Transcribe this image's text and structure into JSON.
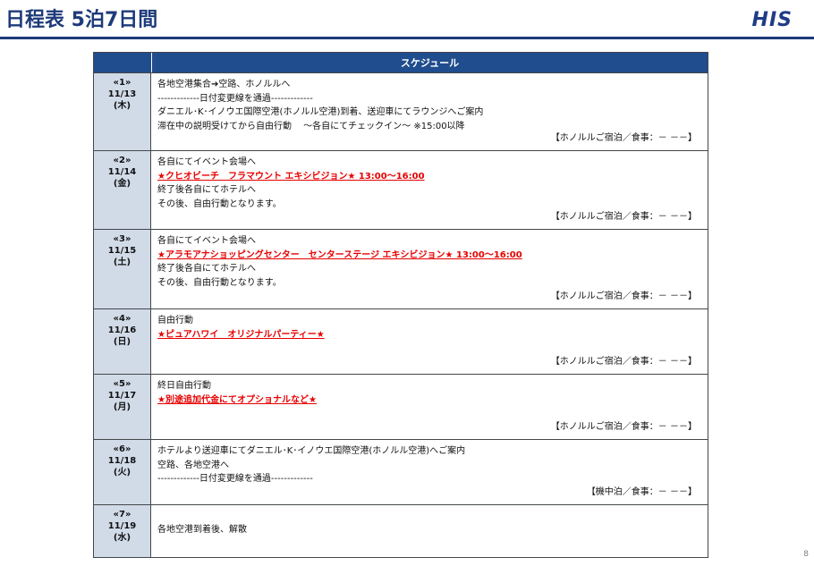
{
  "page": {
    "title": "日程表 5泊7日間",
    "logo_text": "HIS",
    "page_number": "8"
  },
  "table": {
    "header": "スケジュール",
    "rows": [
      {
        "day": "«1»",
        "date": "11/13",
        "weekday": "(木)",
        "lines": [
          {
            "text": "各地空港集合➔空路、ホノルルへ",
            "highlight": false
          },
          {
            "text": "-------------日付変更線を通過-------------",
            "highlight": false
          },
          {
            "text": "ダニエル･K･イノウエ国際空港(ホノルル空港)到着、送迎車にてラウンジへご案内",
            "highlight": false
          },
          {
            "text": "滞在中の説明受けてから自由行動　 ～各自にてチェックイン～ ※15:00以降",
            "highlight": false
          }
        ],
        "accommodation": "【ホノルルご宿泊／食事：－ －－】"
      },
      {
        "day": "«2»",
        "date": "11/14",
        "weekday": "(金)",
        "lines": [
          {
            "text": "各自にてイベント会場へ",
            "highlight": false
          },
          {
            "text": "★クヒオビーチ　フラマウント エキシビジョン★ 13:00～16:00",
            "highlight": true
          },
          {
            "text": "終了後各自にてホテルへ",
            "highlight": false
          },
          {
            "text": "その後、自由行動となります。",
            "highlight": false
          }
        ],
        "accommodation": "【ホノルルご宿泊／食事：－ －－】"
      },
      {
        "day": "«3»",
        "date": "11/15",
        "weekday": "(土)",
        "lines": [
          {
            "text": "各自にてイベント会場へ",
            "highlight": false
          },
          {
            "text": "★アラモアナショッピングセンター　センターステージ エキシビジョン★ 13:00～16:00",
            "highlight": true
          },
          {
            "text": "終了後各自にてホテルへ",
            "highlight": false
          },
          {
            "text": "その後、自由行動となります。",
            "highlight": false
          }
        ],
        "accommodation": "【ホノルルご宿泊／食事：－ －－】"
      },
      {
        "day": "«4»",
        "date": "11/16",
        "weekday": "(日)",
        "lines": [
          {
            "text": "自由行動",
            "highlight": false
          },
          {
            "text": "★ピュアハワイ　オリジナルパーティー★",
            "highlight": true
          }
        ],
        "accommodation": "【ホノルルご宿泊／食事：－ －－】"
      },
      {
        "day": "«5»",
        "date": "11/17",
        "weekday": "(月)",
        "lines": [
          {
            "text": "終日自由行動",
            "highlight": false
          },
          {
            "text": "★別途追加代金にてオプショナルなど★",
            "highlight": true
          }
        ],
        "accommodation": "【ホノルルご宿泊／食事：－ －－】"
      },
      {
        "day": "«6»",
        "date": "11/18",
        "weekday": "(火)",
        "lines": [
          {
            "text": "ホテルより送迎車にてダニエル･K･イノウエ国際空港(ホノルル空港)へご案内",
            "highlight": false
          },
          {
            "text": "空路、各地空港へ",
            "highlight": false
          },
          {
            "text": "-------------日付変更線を通過-------------",
            "highlight": false
          }
        ],
        "accommodation": "【機中泊／食事：－ －－】"
      },
      {
        "day": "«7»",
        "date": "11/19",
        "weekday": "(水)",
        "lines": [
          {
            "text": "各地空港到着後、解散",
            "highlight": false
          }
        ],
        "accommodation": ""
      }
    ]
  }
}
